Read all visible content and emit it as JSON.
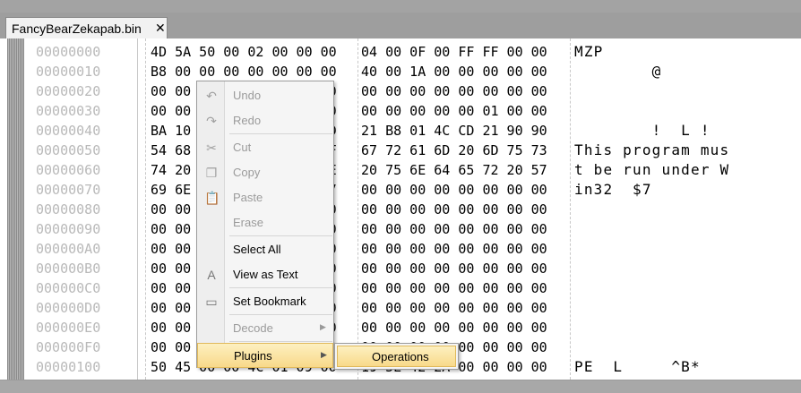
{
  "tab": {
    "title": "FancyBearZekapab.bin",
    "close_glyph": "✕"
  },
  "rows": [
    {
      "addr": "00000000",
      "hex1": "4D 5A 50 00 02 00 00 00",
      "hex2": "04 00 0F 00 FF FF 00 00",
      "ascii": "MZP"
    },
    {
      "addr": "00000010",
      "hex1": "B8 00 00 00 00 00 00 00",
      "hex2": "40 00 1A 00 00 00 00 00",
      "ascii": "        @"
    },
    {
      "addr": "00000020",
      "hex1": "00 00 00 00 00 00 00 00",
      "hex2": "00 00 00 00 00 00 00 00",
      "ascii": ""
    },
    {
      "addr": "00000030",
      "hex1": "00 00 00 00 00 00 00 00",
      "hex2": "00 00 00 00 00 01 00 00",
      "ascii": ""
    },
    {
      "addr": "00000040",
      "hex1": "BA 10 00 0E 1F B4 09 CD",
      "hex2": "21 B8 01 4C CD 21 90 90",
      "ascii": "        !  L !"
    },
    {
      "addr": "00000050",
      "hex1": "54 68 69 73 20 70 72 6F",
      "hex2": "67 72 61 6D 20 6D 75 73",
      "ascii": "This program mus"
    },
    {
      "addr": "00000060",
      "hex1": "74 20 62 65 20 72 75 6E",
      "hex2": "20 75 6E 64 65 72 20 57",
      "ascii": "t be run under W"
    },
    {
      "addr": "00000070",
      "hex1": "69 6E 33 32 0D 0A 24 37",
      "hex2": "00 00 00 00 00 00 00 00",
      "ascii": "in32  $7"
    },
    {
      "addr": "00000080",
      "hex1": "00 00 00 00 00 00 00 00",
      "hex2": "00 00 00 00 00 00 00 00",
      "ascii": ""
    },
    {
      "addr": "00000090",
      "hex1": "00 00 00 00 00 00 00 00",
      "hex2": "00 00 00 00 00 00 00 00",
      "ascii": ""
    },
    {
      "addr": "000000A0",
      "hex1": "00 00 00 00 00 00 00 00",
      "hex2": "00 00 00 00 00 00 00 00",
      "ascii": ""
    },
    {
      "addr": "000000B0",
      "hex1": "00 00 00 00 00 00 00 00",
      "hex2": "00 00 00 00 00 00 00 00",
      "ascii": ""
    },
    {
      "addr": "000000C0",
      "hex1": "00 00 00 00 00 00 00 00",
      "hex2": "00 00 00 00 00 00 00 00",
      "ascii": ""
    },
    {
      "addr": "000000D0",
      "hex1": "00 00 00 00 00 00 00 00",
      "hex2": "00 00 00 00 00 00 00 00",
      "ascii": ""
    },
    {
      "addr": "000000E0",
      "hex1": "00 00 00 00 00 00 00 00",
      "hex2": "00 00 00 00 00 00 00 00",
      "ascii": ""
    },
    {
      "addr": "000000F0",
      "hex1": "00 00 00 00 00 00 00 00",
      "hex2": "00 00 00 00 00 00 00 00",
      "ascii": ""
    },
    {
      "addr": "00000100",
      "hex1": "50 45 00 00 4C 01 09 00",
      "hex2": "19 5E 42 2A 00 00 00 00",
      "ascii": "PE  L     ^B*"
    }
  ],
  "context_menu": {
    "items": [
      {
        "label": "Undo",
        "icon": "undo-icon",
        "glyph": "↶",
        "disabled": true
      },
      {
        "label": "Redo",
        "icon": "redo-icon",
        "glyph": "↷",
        "disabled": true
      },
      {
        "label": "Cut",
        "icon": "scissors-icon",
        "glyph": "✂",
        "disabled": true
      },
      {
        "label": "Copy",
        "icon": "copy-icon",
        "glyph": "❐",
        "disabled": true
      },
      {
        "label": "Paste",
        "icon": "paste-icon",
        "glyph": "📋",
        "disabled": true
      },
      {
        "label": "Erase",
        "icon": "",
        "glyph": "",
        "disabled": true
      },
      {
        "label": "Select All",
        "icon": "",
        "glyph": "",
        "disabled": false
      },
      {
        "label": "View as Text",
        "icon": "text-view-icon",
        "glyph": "A",
        "disabled": false
      },
      {
        "label": "Set Bookmark",
        "icon": "bookmark-icon",
        "glyph": "▭",
        "disabled": false
      },
      {
        "label": "Decode",
        "icon": "",
        "glyph": "",
        "disabled": true,
        "submenu": true
      },
      {
        "label": "Plugins",
        "icon": "",
        "glyph": "",
        "disabled": false,
        "submenu": true,
        "highlighted": true
      }
    ],
    "submenu_arrow": "▶"
  },
  "plugins_submenu": {
    "items": [
      {
        "label": "Operations",
        "highlighted": true
      }
    ]
  },
  "colors": {
    "address_text": "#b9b9b9",
    "disabled_text": "#9b9b9b",
    "highlight_fill": "#f8d98a",
    "highlight_border": "#e0b95a",
    "chrome_gray": "#a9a9a9"
  }
}
